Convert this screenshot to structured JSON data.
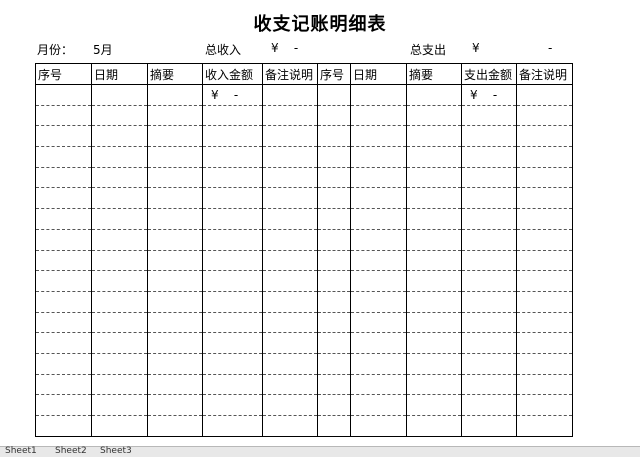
{
  "sheet_title": "收支记账明细表",
  "summary": {
    "month_label": "月份：",
    "month_value": "5月",
    "income_label": "总收入",
    "income_value": "¥    -",
    "expense_label": "总支出",
    "expense_currency": "¥",
    "expense_value": "-"
  },
  "columns": [
    "序号",
    "日期",
    "摘要",
    "收入金额",
    "备注说明",
    "序号",
    "日期",
    "摘要",
    "支出金额",
    "备注说明"
  ],
  "first_row": {
    "income_amount": "¥    -",
    "expense_amount": "¥    -"
  },
  "sheet_tabs": [
    "Sheet1",
    "Sheet2",
    "Sheet3"
  ]
}
